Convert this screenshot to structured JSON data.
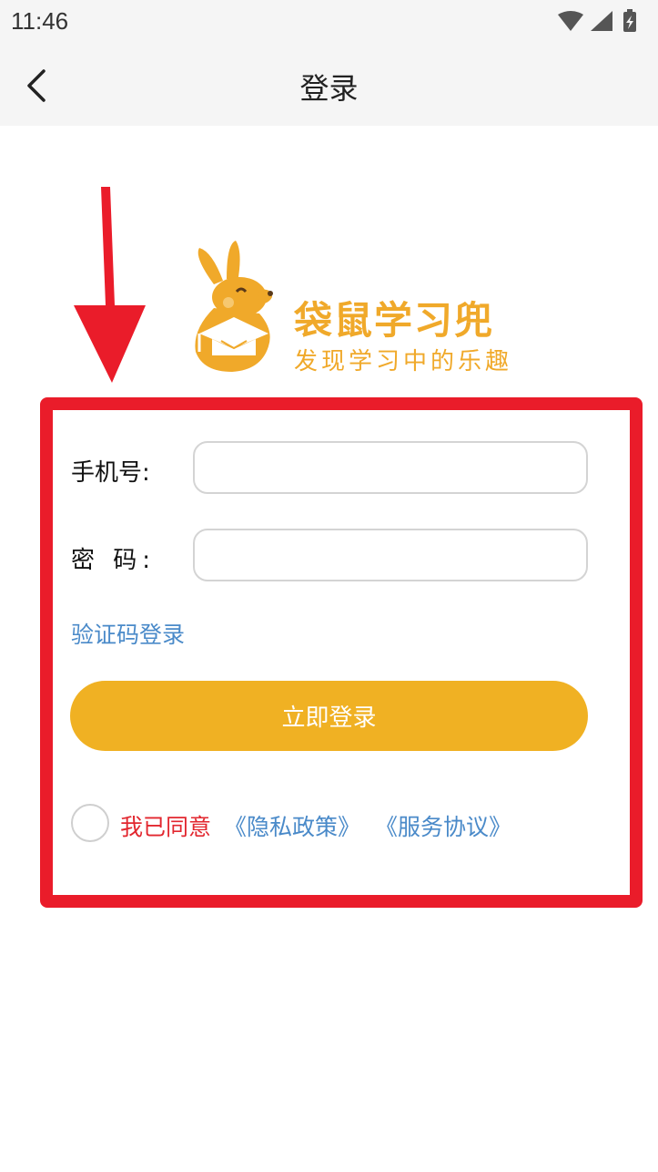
{
  "status_bar": {
    "time": "11:46",
    "icons": [
      "wifi-icon",
      "signal-icon",
      "battery-charging-icon"
    ]
  },
  "nav": {
    "back_icon": "chevron-left-icon",
    "title": "登录"
  },
  "logo": {
    "name": "袋鼠学习兜",
    "slogan": "发现学习中的乐趣",
    "color": "#f0a92a"
  },
  "form": {
    "phone_label": "手机号:",
    "phone_value": "",
    "password_label": "密 码:",
    "password_value": "",
    "code_login_link": "验证码登录",
    "submit_label": "立即登录",
    "agreement": {
      "checked": false,
      "text": "我已同意",
      "privacy_link": "《隐私政策》",
      "service_link": "《服务协议》"
    }
  },
  "colors": {
    "accent": "#f0b123",
    "link": "#4a8ac9",
    "agree_text": "#e2272f",
    "highlight": "#ea1c2a"
  }
}
